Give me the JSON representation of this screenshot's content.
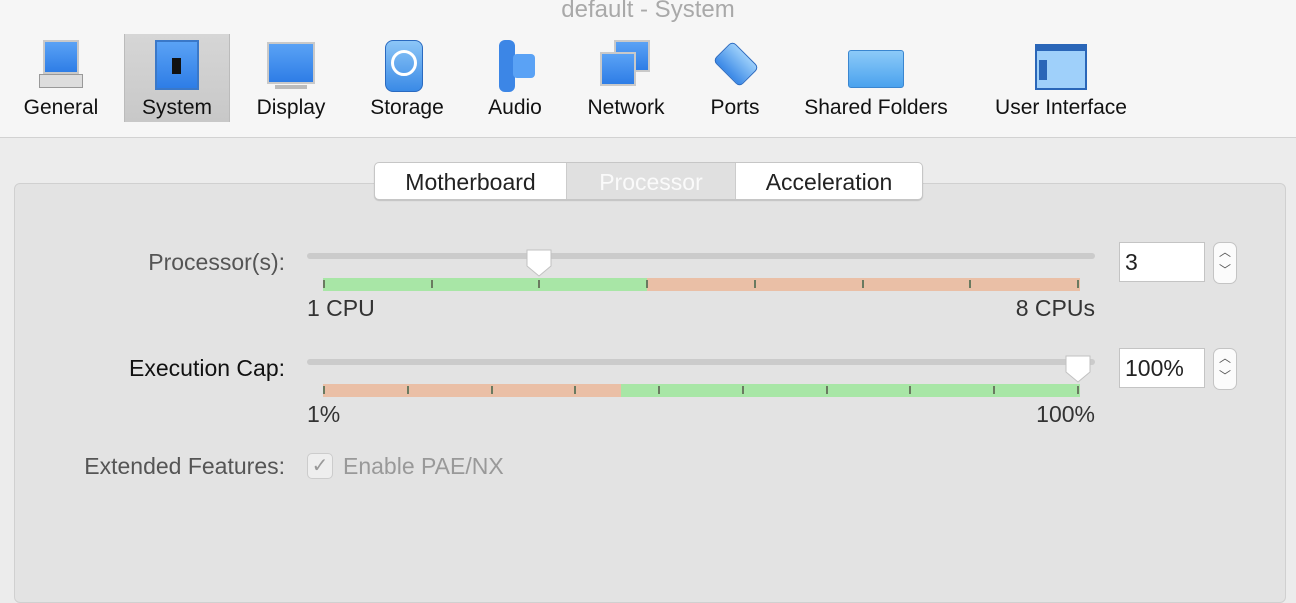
{
  "window": {
    "title": "default - System"
  },
  "toolbar": {
    "items": [
      {
        "label": "General",
        "icon": "general-icon"
      },
      {
        "label": "System",
        "icon": "system-icon",
        "selected": true
      },
      {
        "label": "Display",
        "icon": "display-icon"
      },
      {
        "label": "Storage",
        "icon": "storage-icon"
      },
      {
        "label": "Audio",
        "icon": "audio-icon"
      },
      {
        "label": "Network",
        "icon": "network-icon"
      },
      {
        "label": "Ports",
        "icon": "ports-icon"
      },
      {
        "label": "Shared Folders",
        "icon": "folder-icon"
      },
      {
        "label": "User Interface",
        "icon": "user-interface-icon"
      }
    ]
  },
  "tabs": [
    {
      "label": "Motherboard"
    },
    {
      "label": "Processor",
      "selected": true
    },
    {
      "label": "Acceleration"
    }
  ],
  "processor": {
    "label": "Processor(s):",
    "min_label": "1 CPU",
    "max_label": "8 CPUs",
    "value": "3",
    "min": 1,
    "max": 8,
    "current": 3,
    "recommended_max": 4
  },
  "execution_cap": {
    "label": "Execution Cap:",
    "min_label": "1%",
    "max_label": "100%",
    "value": "100%",
    "min": 1,
    "max": 100,
    "current": 100
  },
  "extended": {
    "label": "Extended Features:",
    "checkbox_label": "Enable PAE/NX",
    "checked": true,
    "enabled": false
  },
  "colors": {
    "green": "#a8e6a6",
    "orange": "#eabfa6"
  }
}
